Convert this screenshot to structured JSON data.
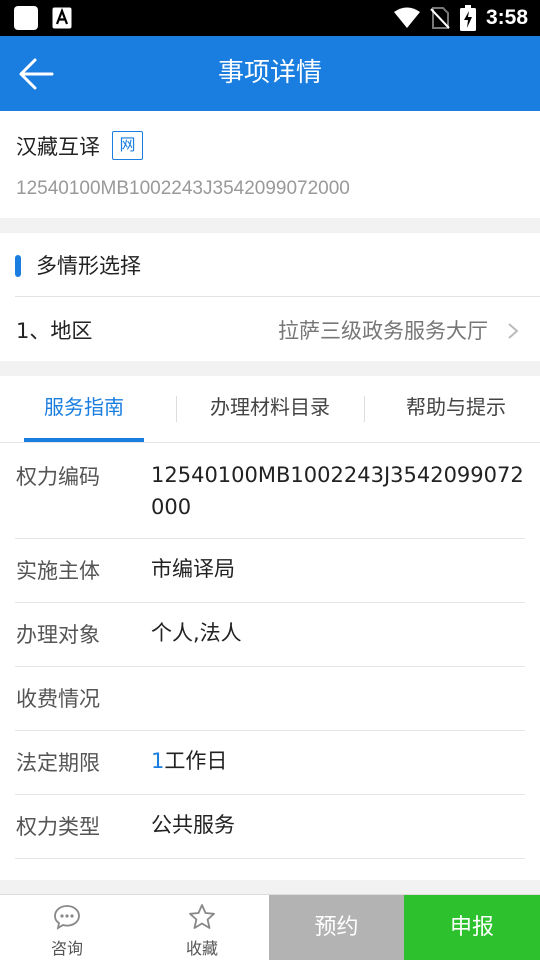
{
  "status_bar": {
    "time": "3:58"
  },
  "app_bar": {
    "title": "事项详情"
  },
  "item": {
    "name": "汉藏互译",
    "badge": "网",
    "code": "12540100MB1002243J3542099072000"
  },
  "situation": {
    "heading": "多情形选择",
    "region_label": "1、地区",
    "region_value": "拉萨三级政务服务大厅"
  },
  "tabs": [
    {
      "label": "服务指南",
      "active": true
    },
    {
      "label": "办理材料目录",
      "active": false
    },
    {
      "label": "帮助与提示",
      "active": false
    }
  ],
  "details": [
    {
      "label": "权力编码",
      "value": "12540100MB1002243J3542099072000"
    },
    {
      "label": "实施主体",
      "value": "市编译局"
    },
    {
      "label": "办理对象",
      "value": "个人,法人"
    },
    {
      "label": "收费情况",
      "value": ""
    },
    {
      "label": "法定期限",
      "value_num": "1",
      "value_unit": "工作日"
    },
    {
      "label": "权力类型",
      "value": "公共服务"
    }
  ],
  "bottom_bar": {
    "consult_label": "咨询",
    "favorite_label": "收藏",
    "appointment_label": "预约",
    "apply_label": "申报"
  },
  "colors": {
    "primary": "#1a7ee0",
    "apply": "#2dc12d",
    "appointment": "#b3b3b3"
  }
}
